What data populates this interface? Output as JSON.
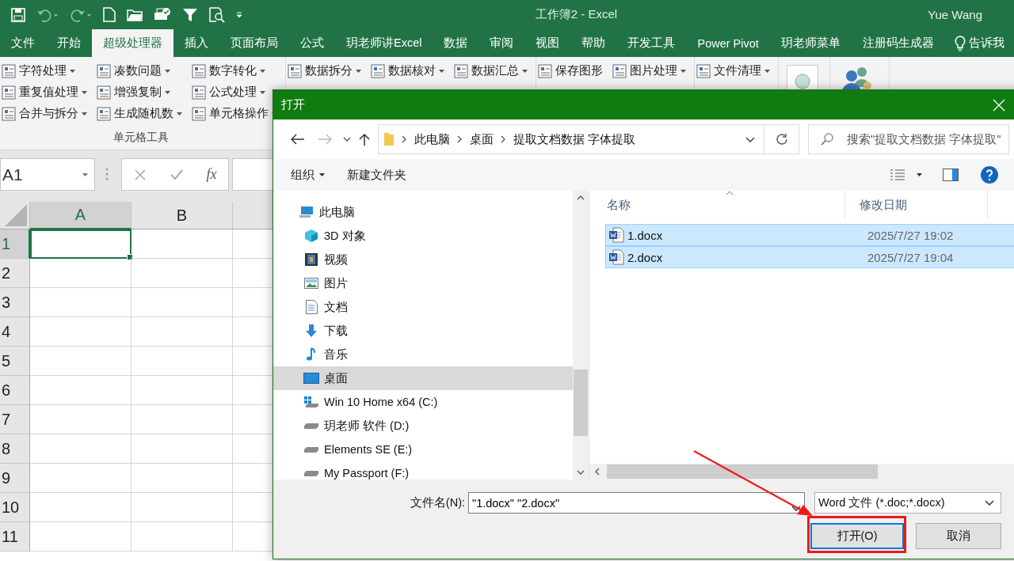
{
  "window": {
    "title": "工作簿2 - Excel",
    "user": "Yue Wang"
  },
  "ribbon_tabs": [
    {
      "label": "文件",
      "selected": false
    },
    {
      "label": "开始",
      "selected": false
    },
    {
      "label": "超级处理器",
      "selected": true
    },
    {
      "label": "插入",
      "selected": false
    },
    {
      "label": "页面布局",
      "selected": false
    },
    {
      "label": "公式",
      "selected": false
    },
    {
      "label": "玥老师讲Excel",
      "selected": false
    },
    {
      "label": "数据",
      "selected": false
    },
    {
      "label": "审阅",
      "selected": false
    },
    {
      "label": "视图",
      "selected": false
    },
    {
      "label": "帮助",
      "selected": false
    },
    {
      "label": "开发工具",
      "selected": false
    },
    {
      "label": "Power Pivot",
      "selected": false
    },
    {
      "label": "玥老师菜单",
      "selected": false
    },
    {
      "label": "注册码生成器",
      "selected": false
    }
  ],
  "tell_me": "告诉我",
  "ribbon_groups": [
    {
      "label": "单元格工具",
      "columns": [
        [
          {
            "label": "字符处理",
            "dropdown": true
          },
          {
            "label": "重复值处理",
            "dropdown": true
          },
          {
            "label": "合并与拆分",
            "dropdown": true
          }
        ],
        [
          {
            "label": "凑数问题",
            "dropdown": true
          },
          {
            "label": "增强复制",
            "dropdown": true
          },
          {
            "label": "生成随机数",
            "dropdown": true
          }
        ],
        [
          {
            "label": "数字转化",
            "dropdown": true
          },
          {
            "label": "公式处理",
            "dropdown": true
          },
          {
            "label": "单元格操作",
            "dropdown": true
          }
        ]
      ]
    },
    {
      "columns": [
        [
          {
            "label": "数据拆分",
            "dropdown": true
          }
        ],
        [
          {
            "label": "数据核对",
            "dropdown": true
          }
        ],
        [
          {
            "label": "数据汇总",
            "dropdown": true
          }
        ]
      ]
    },
    {
      "columns": [
        [
          {
            "label": "保存图形",
            "dropdown": false
          }
        ],
        [
          {
            "label": "图片处理",
            "dropdown": true
          }
        ]
      ]
    },
    {
      "columns": [
        [
          {
            "label": "文件清理",
            "dropdown": true
          }
        ]
      ]
    }
  ],
  "formula_bar": {
    "name_box": "A1",
    "fx": "fx"
  },
  "sheet": {
    "columns": [
      {
        "label": "A",
        "selected": true
      },
      {
        "label": "B",
        "selected": false
      }
    ],
    "rows": [
      {
        "label": "1",
        "selected": true
      },
      {
        "label": "2",
        "selected": false
      },
      {
        "label": "3",
        "selected": false
      },
      {
        "label": "4",
        "selected": false
      },
      {
        "label": "5",
        "selected": false
      },
      {
        "label": "6",
        "selected": false
      },
      {
        "label": "7",
        "selected": false
      },
      {
        "label": "8",
        "selected": false
      },
      {
        "label": "9",
        "selected": false
      },
      {
        "label": "10",
        "selected": false
      },
      {
        "label": "11",
        "selected": false
      }
    ]
  },
  "dialog": {
    "title": "打开",
    "breadcrumb": [
      "此电脑",
      "桌面",
      "提取文档数据 字体提取"
    ],
    "search": {
      "placeholder": "搜索\"提取文档数据 字体提取\""
    },
    "toolbar": {
      "organize": "组织",
      "new_folder": "新建文件夹"
    },
    "nav_tree": [
      {
        "label": "此电脑",
        "kind": "computer",
        "selected": false,
        "children": [
          {
            "label": "3D 对象",
            "kind": "cube",
            "selected": false
          },
          {
            "label": "视频",
            "kind": "video",
            "selected": false
          },
          {
            "label": "图片",
            "kind": "picture",
            "selected": false
          },
          {
            "label": "文档",
            "kind": "document",
            "selected": false
          },
          {
            "label": "下载",
            "kind": "download",
            "selected": false
          },
          {
            "label": "音乐",
            "kind": "music",
            "selected": false
          },
          {
            "label": "桌面",
            "kind": "desktop",
            "selected": true
          },
          {
            "label": "Win 10 Home x64 (C:)",
            "kind": "system-drive",
            "selected": false
          },
          {
            "label": "玥老师 软件 (D:)",
            "kind": "drive",
            "selected": false
          },
          {
            "label": "Elements SE (E:)",
            "kind": "drive",
            "selected": false
          },
          {
            "label": "My Passport (F:)",
            "kind": "drive",
            "selected": false
          }
        ]
      }
    ],
    "file_columns": [
      "名称",
      "修改日期"
    ],
    "files": [
      {
        "name": "1.docx",
        "modified": "2025/7/27 19:02",
        "selected": true
      },
      {
        "name": "2.docx",
        "modified": "2025/7/27 19:04",
        "selected": true
      }
    ],
    "file_name": {
      "label": "文件名(N):",
      "value": "\"1.docx\" \"2.docx\""
    },
    "file_type": {
      "value": "Word 文件 (*.doc;*.docx)"
    },
    "buttons": [
      {
        "label": "打开(O)",
        "kind": "primary"
      },
      {
        "label": "取消",
        "kind": "secondary"
      }
    ]
  }
}
